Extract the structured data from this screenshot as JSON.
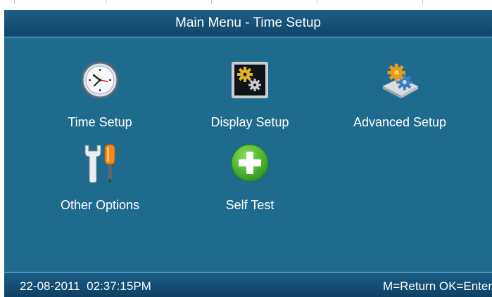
{
  "window": {
    "title": "Main Menu - Time Setup"
  },
  "menu": {
    "items": [
      {
        "label": "Time Setup",
        "icon": "clock-icon"
      },
      {
        "label": "Display Setup",
        "icon": "display-gears-icon"
      },
      {
        "label": "Advanced Setup",
        "icon": "advanced-gears-icon"
      },
      {
        "label": "Other Options",
        "icon": "tools-icon"
      },
      {
        "label": "Self Test",
        "icon": "plus-icon"
      }
    ]
  },
  "status": {
    "datetime": "22-08-2011  02:37:15PM",
    "hint": "M=Return OK=Enter"
  },
  "colors": {
    "background": "#1f6b8e",
    "title_bar": "#11456a",
    "status_bar": "#0f4066",
    "text": "#ffffff"
  }
}
